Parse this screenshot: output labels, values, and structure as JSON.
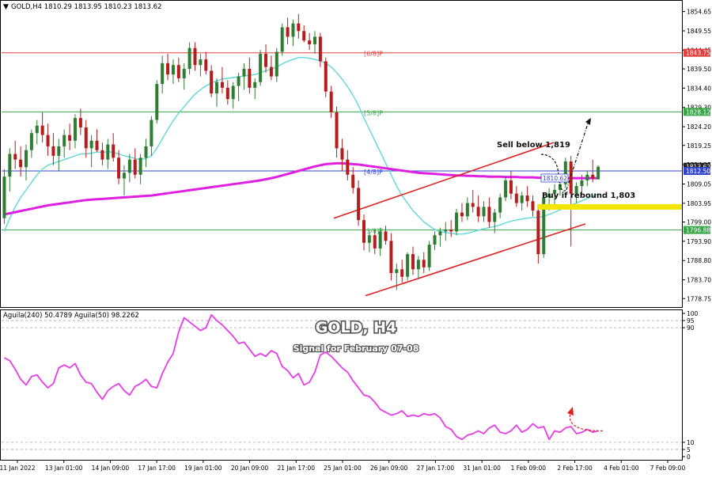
{
  "header": {
    "symbol_line": "GOLD,H4  1810.29 1813.95 1810.23 1813.62",
    "indicator_line": "Aguila(240) 50.4789  Aguila(50) 98.2262"
  },
  "overlay": {
    "title": "GOLD, H4",
    "subtitle": "Signal for February 07-08",
    "sell_text": "Sell below 1,819",
    "buy_text": "Buy if rebound 1,803"
  },
  "colors": {
    "bull": "#2e7d32",
    "bear": "#b71c1c",
    "ema_fast": "#5fd8d8",
    "ema_slow": "#e020e0",
    "channel": "#e02020",
    "level_red": "#e04040",
    "level_green": "#3aa64a",
    "level_blue": "#3344cc",
    "highlight": "#f2e600",
    "osc": "#e83ce8"
  },
  "chart_data": [
    {
      "type": "candlestick",
      "title": "GOLD,H4",
      "ylim": [
        1776.5,
        1857.5
      ],
      "y_ticks": [
        1854.65,
        1849.55,
        1844.45,
        1839.5,
        1834.4,
        1829.3,
        1824.2,
        1819.25,
        1814.15,
        1809.05,
        1803.95,
        1799.0,
        1793.9,
        1788.8,
        1783.7,
        1778.75
      ],
      "x_labels": [
        "11 Jan 2022",
        "13 Jan 01:00",
        "14 Jan 09:00",
        "17 Jan 17:00",
        "19 Jan 01:00",
        "20 Jan 09:00",
        "21 Jan 17:00",
        "25 Jan 01:00",
        "26 Jan 09:00",
        "27 Jan 17:00",
        "31 Jan 01:00",
        "1 Feb 09:00",
        "2 Feb 17:00",
        "4 Feb 01:00",
        "7 Feb 09:00"
      ],
      "levels": [
        {
          "label": "[6/8]P",
          "value": 1843.75,
          "color": "red"
        },
        {
          "label": "[5/8]P",
          "value": 1828.12,
          "color": "green"
        },
        {
          "label": "[4/8]P",
          "value": 1812.5,
          "color": "blue"
        },
        {
          "label": "[3/8]P",
          "value": 1796.88,
          "color": "green"
        }
      ],
      "price_tags": [
        {
          "value": 1813.62,
          "text": "1813.62"
        },
        {
          "value": 1812.5,
          "text": "1812.50"
        }
      ],
      "ema_slow_tag": {
        "value": 1810.62,
        "text": "1810.62"
      },
      "candles": [
        [
          1800.0,
          1813.0,
          1798.5,
          1811.0
        ],
        [
          1811.0,
          1818.5,
          1807.0,
          1817.0
        ],
        [
          1817.0,
          1820.5,
          1813.0,
          1815.5
        ],
        [
          1815.5,
          1819.0,
          1811.0,
          1813.5
        ],
        [
          1813.5,
          1819.5,
          1810.0,
          1818.0
        ],
        [
          1818.0,
          1823.5,
          1816.0,
          1822.5
        ],
        [
          1822.5,
          1826.0,
          1819.5,
          1824.5
        ],
        [
          1824.5,
          1828.0,
          1820.0,
          1822.0
        ],
        [
          1822.0,
          1825.0,
          1816.5,
          1819.0
        ],
        [
          1819.0,
          1822.5,
          1814.0,
          1816.5
        ],
        [
          1816.5,
          1821.0,
          1812.5,
          1819.0
        ],
        [
          1819.0,
          1823.5,
          1816.0,
          1822.0
        ],
        [
          1822.0,
          1825.0,
          1818.0,
          1820.5
        ],
        [
          1820.5,
          1827.5,
          1818.5,
          1826.5
        ],
        [
          1826.5,
          1829.0,
          1822.0,
          1824.0
        ],
        [
          1824.0,
          1826.0,
          1816.0,
          1818.5
        ],
        [
          1818.5,
          1822.0,
          1813.5,
          1820.5
        ],
        [
          1820.5,
          1823.5,
          1817.5,
          1818.0
        ],
        [
          1818.0,
          1820.0,
          1814.0,
          1815.5
        ],
        [
          1815.5,
          1821.0,
          1813.0,
          1819.5
        ],
        [
          1819.5,
          1822.5,
          1815.0,
          1816.0
        ],
        [
          1816.0,
          1818.0,
          1809.0,
          1810.5
        ],
        [
          1810.5,
          1814.0,
          1806.0,
          1812.0
        ],
        [
          1812.0,
          1817.0,
          1809.5,
          1815.5
        ],
        [
          1815.5,
          1818.5,
          1810.5,
          1811.5
        ],
        [
          1811.5,
          1817.0,
          1809.0,
          1816.0
        ],
        [
          1816.0,
          1821.0,
          1813.5,
          1819.0
        ],
        [
          1819.0,
          1827.0,
          1816.5,
          1826.0
        ],
        [
          1826.0,
          1836.5,
          1825.0,
          1835.5
        ],
        [
          1835.5,
          1843.0,
          1833.0,
          1841.0
        ],
        [
          1841.0,
          1843.5,
          1836.5,
          1838.0
        ],
        [
          1838.0,
          1842.0,
          1835.5,
          1840.5
        ],
        [
          1840.5,
          1842.5,
          1836.0,
          1837.0
        ],
        [
          1837.0,
          1841.0,
          1834.0,
          1839.5
        ],
        [
          1839.5,
          1846.5,
          1838.0,
          1845.0
        ],
        [
          1845.0,
          1846.5,
          1839.0,
          1840.5
        ],
        [
          1840.5,
          1843.5,
          1837.5,
          1842.0
        ],
        [
          1842.0,
          1844.0,
          1838.0,
          1839.0
        ],
        [
          1839.0,
          1840.5,
          1832.0,
          1833.0
        ],
        [
          1833.0,
          1837.0,
          1829.5,
          1836.0
        ],
        [
          1836.0,
          1840.0,
          1833.0,
          1834.5
        ],
        [
          1834.5,
          1836.5,
          1830.0,
          1831.5
        ],
        [
          1831.5,
          1836.0,
          1829.0,
          1835.0
        ],
        [
          1835.0,
          1838.5,
          1831.0,
          1837.5
        ],
        [
          1837.5,
          1841.0,
          1834.0,
          1839.5
        ],
        [
          1839.5,
          1842.5,
          1833.0,
          1834.5
        ],
        [
          1834.5,
          1837.0,
          1831.5,
          1836.0
        ],
        [
          1836.0,
          1844.5,
          1835.0,
          1843.5
        ],
        [
          1843.5,
          1846.0,
          1838.5,
          1840.0
        ],
        [
          1840.0,
          1843.0,
          1836.5,
          1837.5
        ],
        [
          1837.5,
          1845.0,
          1836.0,
          1844.0
        ],
        [
          1844.0,
          1851.5,
          1843.0,
          1850.5
        ],
        [
          1850.5,
          1853.0,
          1846.0,
          1848.0
        ],
        [
          1848.0,
          1852.5,
          1845.5,
          1851.5
        ],
        [
          1851.5,
          1854.0,
          1847.5,
          1849.5
        ],
        [
          1849.5,
          1851.0,
          1846.5,
          1847.0
        ],
        [
          1847.0,
          1849.0,
          1844.5,
          1846.0
        ],
        [
          1846.0,
          1849.5,
          1843.5,
          1848.0
        ],
        [
          1848.0,
          1849.0,
          1840.0,
          1841.5
        ],
        [
          1841.5,
          1842.5,
          1832.0,
          1833.5
        ],
        [
          1833.5,
          1835.0,
          1826.5,
          1828.0
        ],
        [
          1828.0,
          1829.5,
          1816.0,
          1818.5
        ],
        [
          1818.5,
          1821.0,
          1812.5,
          1815.5
        ],
        [
          1815.5,
          1818.0,
          1810.0,
          1811.5
        ],
        [
          1811.5,
          1813.5,
          1806.5,
          1808.0
        ],
        [
          1808.0,
          1810.0,
          1798.0,
          1799.5
        ],
        [
          1799.5,
          1801.0,
          1791.5,
          1793.5
        ],
        [
          1793.5,
          1796.5,
          1791.0,
          1795.5
        ],
        [
          1795.5,
          1797.0,
          1790.5,
          1792.0
        ],
        [
          1792.0,
          1797.5,
          1790.0,
          1796.5
        ],
        [
          1796.5,
          1798.0,
          1793.0,
          1794.0
        ],
        [
          1794.0,
          1796.0,
          1783.5,
          1785.5
        ],
        [
          1785.5,
          1788.0,
          1781.0,
          1786.5
        ],
        [
          1786.5,
          1789.0,
          1783.0,
          1784.5
        ],
        [
          1784.5,
          1791.0,
          1783.5,
          1790.5
        ],
        [
          1790.5,
          1792.5,
          1785.0,
          1786.5
        ],
        [
          1786.5,
          1790.0,
          1784.0,
          1789.0
        ],
        [
          1789.0,
          1791.0,
          1785.5,
          1787.0
        ],
        [
          1787.0,
          1794.0,
          1786.0,
          1793.0
        ],
        [
          1793.0,
          1796.5,
          1791.5,
          1795.5
        ],
        [
          1795.5,
          1797.5,
          1792.5,
          1796.5
        ],
        [
          1796.5,
          1799.0,
          1794.0,
          1797.0
        ],
        [
          1797.0,
          1799.5,
          1795.0,
          1796.5
        ],
        [
          1796.5,
          1802.5,
          1795.5,
          1801.5
        ],
        [
          1801.5,
          1804.0,
          1799.0,
          1800.5
        ],
        [
          1800.5,
          1805.5,
          1799.5,
          1804.0
        ],
        [
          1804.0,
          1807.5,
          1801.5,
          1803.0
        ],
        [
          1803.0,
          1806.0,
          1799.0,
          1800.5
        ],
        [
          1800.5,
          1804.5,
          1799.0,
          1803.0
        ],
        [
          1803.0,
          1805.5,
          1797.5,
          1799.0
        ],
        [
          1799.0,
          1802.5,
          1796.0,
          1801.5
        ],
        [
          1801.5,
          1806.5,
          1800.0,
          1805.5
        ],
        [
          1805.5,
          1811.0,
          1804.5,
          1810.0
        ],
        [
          1810.0,
          1812.5,
          1805.0,
          1806.5
        ],
        [
          1806.5,
          1808.5,
          1803.0,
          1804.0
        ],
        [
          1804.0,
          1807.0,
          1802.0,
          1806.0
        ],
        [
          1806.0,
          1808.5,
          1803.0,
          1804.5
        ],
        [
          1804.5,
          1806.0,
          1800.5,
          1802.0
        ],
        [
          1802.0,
          1803.0,
          1788.0,
          1790.5
        ],
        [
          1790.5,
          1806.0,
          1789.5,
          1805.5
        ],
        [
          1805.5,
          1808.0,
          1802.0,
          1806.5
        ],
        [
          1806.5,
          1809.0,
          1803.0,
          1807.5
        ],
        [
          1807.5,
          1810.5,
          1806.0,
          1809.0
        ],
        [
          1809.0,
          1816.0,
          1808.0,
          1815.0
        ],
        [
          1815.0,
          1816.5,
          1792.5,
          1806.5
        ],
        [
          1806.5,
          1809.5,
          1804.0,
          1808.5
        ],
        [
          1808.5,
          1811.5,
          1806.0,
          1810.0
        ],
        [
          1810.0,
          1812.5,
          1808.5,
          1811.5
        ],
        [
          1811.5,
          1815.5,
          1809.5,
          1810.5
        ],
        [
          1810.29,
          1813.95,
          1810.23,
          1813.62
        ]
      ],
      "ema_fast": [
        1796.5,
        1800.0,
        1803.0,
        1805.5,
        1807.5,
        1809.5,
        1811.5,
        1813.0,
        1814.0,
        1814.5,
        1815.0,
        1815.5,
        1816.0,
        1816.5,
        1817.0,
        1817.0,
        1817.2,
        1817.5,
        1817.4,
        1817.6,
        1817.4,
        1817.0,
        1816.5,
        1816.2,
        1815.8,
        1815.5,
        1815.8,
        1816.5,
        1818.5,
        1821.0,
        1823.5,
        1825.8,
        1827.8,
        1829.5,
        1831.2,
        1832.8,
        1834.0,
        1835.0,
        1835.8,
        1836.3,
        1836.8,
        1837.0,
        1837.2,
        1837.4,
        1837.6,
        1837.8,
        1838.0,
        1838.5,
        1839.0,
        1839.5,
        1840.0,
        1840.8,
        1841.5,
        1842.0,
        1842.5,
        1842.5,
        1842.3,
        1842.0,
        1841.6,
        1841.0,
        1840.0,
        1838.5,
        1836.8,
        1834.8,
        1832.5,
        1829.8,
        1826.5,
        1823.5,
        1820.5,
        1817.5,
        1814.5,
        1811.5,
        1808.5,
        1806.0,
        1804.0,
        1802.0,
        1800.5,
        1799.0,
        1798.0,
        1797.0,
        1796.5,
        1796.2,
        1796.0,
        1795.8,
        1795.8,
        1796.0,
        1796.4,
        1796.8,
        1797.2,
        1797.5,
        1797.8,
        1798.2,
        1798.8,
        1799.2,
        1799.5,
        1799.8,
        1800.0,
        1800.2,
        1800.2,
        1800.5,
        1801.0,
        1801.6,
        1802.2,
        1803.0,
        1803.5,
        1804.0,
        1804.6,
        1805.2,
        1805.8,
        1806.4
      ],
      "ema_slow": [
        1801.0,
        1801.3,
        1801.6,
        1801.9,
        1802.2,
        1802.5,
        1802.8,
        1803.1,
        1803.4,
        1803.6,
        1803.8,
        1804.0,
        1804.2,
        1804.4,
        1804.6,
        1804.8,
        1804.9,
        1805.0,
        1805.1,
        1805.2,
        1805.3,
        1805.4,
        1805.5,
        1805.6,
        1805.7,
        1805.8,
        1805.9,
        1806.0,
        1806.2,
        1806.4,
        1806.6,
        1806.8,
        1807.0,
        1807.2,
        1807.4,
        1807.6,
        1807.8,
        1808.0,
        1808.2,
        1808.4,
        1808.6,
        1808.8,
        1809.0,
        1809.2,
        1809.4,
        1809.6,
        1809.8,
        1810.0,
        1810.3,
        1810.6,
        1810.9,
        1811.3,
        1811.7,
        1812.1,
        1812.5,
        1812.9,
        1813.3,
        1813.7,
        1814.0,
        1814.3,
        1814.4,
        1814.5,
        1814.5,
        1814.4,
        1814.3,
        1814.2,
        1814.0,
        1813.8,
        1813.6,
        1813.4,
        1813.2,
        1813.0,
        1812.8,
        1812.6,
        1812.4,
        1812.2,
        1812.0,
        1811.9,
        1811.8,
        1811.7,
        1811.6,
        1811.5,
        1811.4,
        1811.3,
        1811.3,
        1811.2,
        1811.2,
        1811.1,
        1811.1,
        1811.0,
        1811.0,
        1811.0,
        1810.9,
        1810.9,
        1810.9,
        1810.8,
        1810.8,
        1810.8,
        1810.7,
        1810.7,
        1810.7,
        1810.7,
        1810.6,
        1810.6,
        1810.6,
        1810.6,
        1810.6,
        1810.6,
        1810.6,
        1810.6
      ]
    },
    {
      "type": "line",
      "title": "Aguila(240) 50.4789  Aguila(50) 98.2262",
      "ylim": [
        0,
        100
      ],
      "y_ticks": [
        100,
        95,
        90,
        10,
        5,
        0
      ],
      "values": [
        69,
        67,
        61,
        54,
        50,
        56,
        57,
        52,
        48,
        51,
        62,
        64,
        62,
        65,
        57,
        52,
        51,
        45,
        40,
        46,
        49,
        51,
        46,
        43,
        49,
        51,
        54,
        49,
        48,
        58,
        66,
        72,
        87,
        97,
        94,
        91,
        88,
        90,
        99,
        95,
        92,
        88,
        84,
        79,
        80,
        75,
        70,
        72,
        70,
        74,
        72,
        63,
        60,
        55,
        58,
        50,
        52,
        59,
        71,
        73,
        70,
        66,
        62,
        59,
        53,
        48,
        43,
        42,
        38,
        33,
        31,
        29,
        30,
        32,
        28,
        29,
        28,
        30,
        29,
        30,
        27,
        21,
        19,
        14,
        12,
        15,
        16,
        18,
        16,
        20,
        22,
        17,
        16,
        18,
        22,
        17,
        19,
        23,
        20,
        21,
        12,
        18,
        17,
        20,
        21,
        16,
        17,
        19,
        17,
        18
      ],
      "projection_end": 22
    }
  ]
}
